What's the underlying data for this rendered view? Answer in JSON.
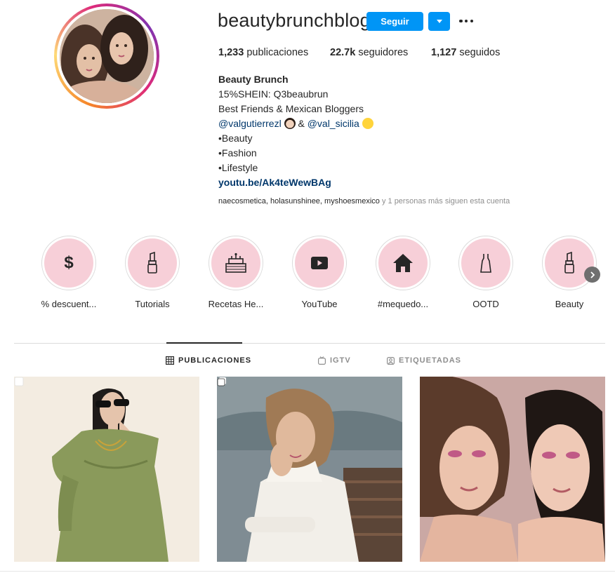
{
  "profile": {
    "username": "beautybrunchblog",
    "follow_label": "Seguir",
    "avatar_icon": "profile-photo",
    "stats": {
      "posts_count": "1,233",
      "posts_label": "publicaciones",
      "followers_count": "22.7k",
      "followers_label": "seguidores",
      "following_count": "1,127",
      "following_label": "seguidos"
    },
    "bio": {
      "name": "Beauty Brunch",
      "line1": "15%SHEIN: Q3beaubrun",
      "line2": "Best Friends & Mexican Bloggers",
      "mention1": "@valgutierrezl",
      "amp": "&",
      "mention2": "@val_sicilia",
      "item1": "•Beauty",
      "item2": "•Fashion",
      "item3": "•Lifestyle",
      "link": "youtu.be/Ak4teWewBAg"
    },
    "followed_by": {
      "names": "naecosmetica, holasunshinee, myshoesmexico",
      "suffix": " y 1 personas más siguen esta cuenta"
    }
  },
  "highlights": [
    {
      "label": "% descuent...",
      "icon": "dollar-icon"
    },
    {
      "label": "Tutorials",
      "icon": "lipstick-icon"
    },
    {
      "label": "Recetas He...",
      "icon": "cake-icon"
    },
    {
      "label": "YouTube",
      "icon": "youtube-icon"
    },
    {
      "label": "#mequedo...",
      "icon": "home-icon"
    },
    {
      "label": "OOTD",
      "icon": "dress-icon"
    },
    {
      "label": "Beauty",
      "icon": "lipstick-icon"
    }
  ],
  "tabs": {
    "posts": "PUBLICACIONES",
    "igtv": "IGTV",
    "tagged": "ETIQUETADAS"
  },
  "colors": {
    "accent": "#0095f6",
    "highlight_bg": "#f7cfd8",
    "link": "#00376b",
    "muted": "#8e8e8e"
  }
}
